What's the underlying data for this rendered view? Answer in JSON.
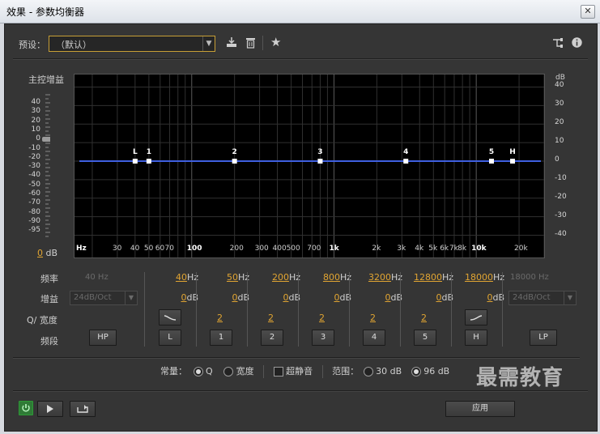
{
  "window": {
    "title": "效果 - 参数均衡器",
    "close": "✕"
  },
  "toolbar": {
    "preset_label": "预设：",
    "preset_value": "（默认）"
  },
  "graph": {
    "master_gain_label": "主控增益",
    "master_gain_value": "0",
    "master_gain_unit": "dB",
    "left_ticks": [
      "40",
      "30",
      "20",
      "10",
      "0",
      "-10",
      "-20",
      "-30",
      "-40",
      "-50",
      "-60",
      "-70",
      "-80",
      "-90",
      "-95"
    ],
    "right_unit": "dB",
    "right_ticks": [
      "40",
      "30",
      "20",
      "10",
      "0",
      "-10",
      "-20",
      "-30",
      "-40"
    ],
    "x_ticks": [
      "Hz",
      "30",
      "40",
      "50",
      "60",
      "70",
      "100",
      "200",
      "300",
      "400",
      "500",
      "700",
      "1k",
      "2k",
      "3k",
      "4k",
      "5k",
      "6k",
      "7k",
      "8k",
      "10k",
      "20k"
    ],
    "curve_db": 0,
    "nodes": [
      {
        "label": "L",
        "freq": 40
      },
      {
        "label": "1",
        "freq": 50
      },
      {
        "label": "2",
        "freq": 200
      },
      {
        "label": "3",
        "freq": 800
      },
      {
        "label": "4",
        "freq": 3200
      },
      {
        "label": "5",
        "freq": 12800
      },
      {
        "label": "H",
        "freq": 18000
      }
    ]
  },
  "bands": {
    "row_labels": {
      "freq": "频率",
      "gain": "增益",
      "q": "Q/ 宽度",
      "band": "频段"
    },
    "hp": {
      "freq": "40",
      "unit": "Hz",
      "gain": "24dB/Oct",
      "button": "HP"
    },
    "lp": {
      "freq": "18000",
      "unit": "Hz",
      "gain": "24dB/Oct",
      "button": "LP"
    },
    "cols": [
      {
        "freq": "40",
        "unit": "Hz",
        "gain": "0",
        "gain_unit": "dB",
        "q": "",
        "button": "L"
      },
      {
        "freq": "50",
        "unit": "Hz",
        "gain": "0",
        "gain_unit": "dB",
        "q": "2",
        "button": "1"
      },
      {
        "freq": "200",
        "unit": "Hz",
        "gain": "0",
        "gain_unit": "dB",
        "q": "2",
        "button": "2"
      },
      {
        "freq": "800",
        "unit": "Hz",
        "gain": "0",
        "gain_unit": "dB",
        "q": "2",
        "button": "3"
      },
      {
        "freq": "3200",
        "unit": "Hz",
        "gain": "0",
        "gain_unit": "dB",
        "q": "2",
        "button": "4"
      },
      {
        "freq": "12800",
        "unit": "Hz",
        "gain": "0",
        "gain_unit": "dB",
        "q": "2",
        "button": "5"
      },
      {
        "freq": "18000",
        "unit": "Hz",
        "gain": "0",
        "gain_unit": "dB",
        "q": "",
        "button": "H"
      }
    ]
  },
  "options": {
    "constant_label": "常量：",
    "q_label": "Q",
    "width_label": "宽度",
    "ultra_quiet_label": "超静音",
    "range_label": "范围：",
    "range_30": "30 dB",
    "range_96": "96 dB"
  },
  "footer": {
    "apply_label": "应用"
  },
  "watermark": "最需教育",
  "colors": {
    "accent": "#e0a432",
    "curve": "#3f5fe0",
    "power": "#3cc44a"
  }
}
